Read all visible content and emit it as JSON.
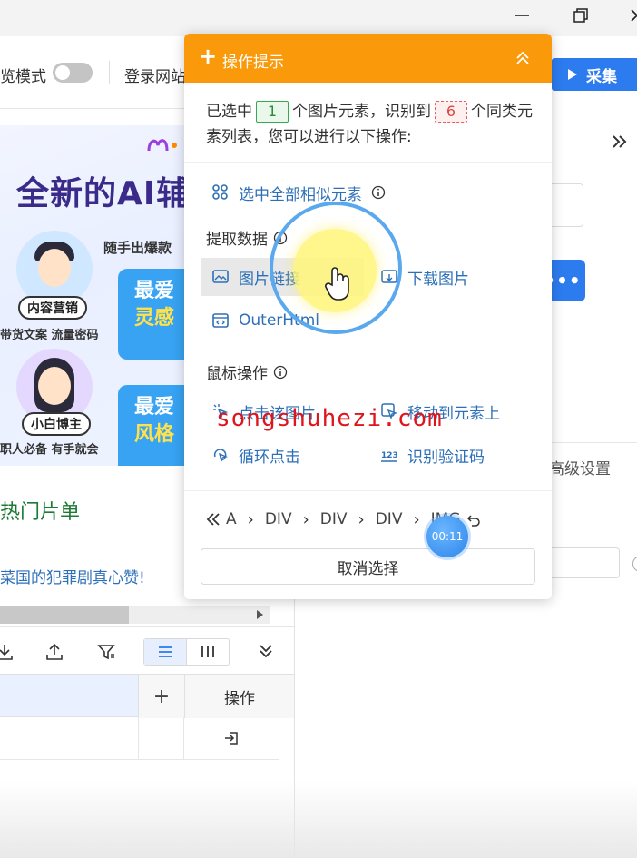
{
  "window": {
    "controls": [
      "minimize-icon",
      "maximize-icon",
      "close-icon"
    ]
  },
  "toolbar": {
    "browse_mode_label": "览模式",
    "login_label": "登录网站",
    "collect_label": "采集"
  },
  "preview": {
    "big_title": "全新的AI辅",
    "subtitle": "随手出爆款",
    "role1": "内容营销",
    "role1_desc": "带货文案 流量密码",
    "role2": "小白博主",
    "role2_desc": "职人必备 有手就会",
    "love1_a": "最爱",
    "love1_b": "灵感",
    "love2_a": "最爱",
    "love2_b": "风格"
  },
  "left": {
    "hot_list": "热门片单",
    "drama_link": "菜国的犯罪剧真心赞!",
    "table_op_header": "操作",
    "add_column": "+"
  },
  "right": {
    "more_btn": "•••",
    "advanced_tab": "高级设置"
  },
  "popup": {
    "title": "操作提示",
    "info_prefix": "已选中",
    "selected_count": "1",
    "info_mid": "个图片元素，识别到",
    "similar_count": "6",
    "info_suffix": "个同类元素列表，您可以进行以下操作:",
    "select_all_similar": "选中全部相似元素",
    "section_extract": "提取数据",
    "image_link": "图片链接",
    "download_image": "下载图片",
    "outer_html": "OuterHtml",
    "section_mouse": "鼠标操作",
    "click_image": "点击该图片",
    "move_to_element": "移动到元素上",
    "loop_click": "循环点击",
    "recognize_captcha": "识别验证码",
    "path": [
      "A",
      "DIV",
      "DIV",
      "DIV",
      "IMG"
    ],
    "cancel_selection": "取消选择"
  },
  "overlay": {
    "watermark": "songshuhezi.com",
    "timer": "00:11"
  },
  "colors": {
    "popup_header": "#fa9a0a",
    "accent_blue": "#2c7cf0",
    "link_blue": "#2d6fb8",
    "watermark_red": "#e0151c"
  }
}
